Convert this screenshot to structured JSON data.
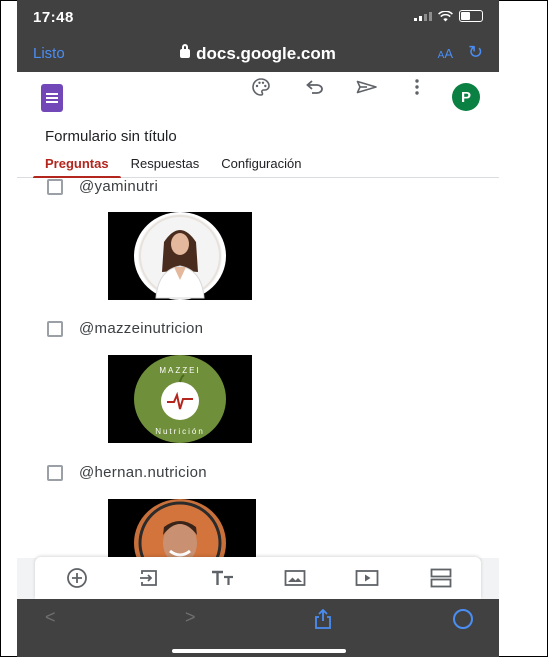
{
  "status": {
    "time": "17:48"
  },
  "browser": {
    "done_label": "Listo",
    "url": "docs.google.com",
    "aa_small": "A",
    "aa_big": "A"
  },
  "form": {
    "title": "Formulario sin título",
    "tabs": [
      {
        "label": "Preguntas",
        "active": true
      },
      {
        "label": "Respuestas",
        "active": false
      },
      {
        "label": "Configuración",
        "active": false
      }
    ],
    "options": [
      {
        "label": "@yaminutri",
        "image": "profile-photo-woman"
      },
      {
        "label": "@mazzeinutricion",
        "image": "mazzei-nutricion-logo"
      },
      {
        "label": "@hernan.nutricion",
        "image": "profile-photo-man"
      }
    ],
    "logo_text_top": "MAZZEI",
    "logo_text_bottom": "Nutrición"
  },
  "header_icons": [
    "palette-icon",
    "undo-icon",
    "send-icon",
    "more-vert-icon"
  ],
  "account_initial": "P",
  "toolbar_icons": [
    "add-question-icon",
    "import-questions-icon",
    "add-title-icon",
    "add-image-icon",
    "add-video-icon",
    "add-section-icon"
  ],
  "colors": {
    "forms_purple": "#7248b9",
    "active_tab": "#b3261e",
    "avatar_green": "#0b8043",
    "ios_blue": "#4a8ef4",
    "chrome_gray": "#414141",
    "mazzei_green": "#6f8f3a"
  }
}
